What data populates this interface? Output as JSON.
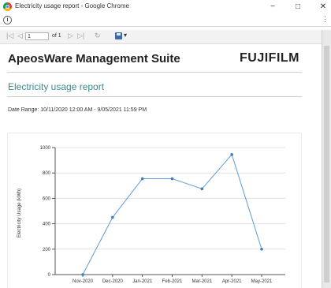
{
  "window": {
    "title": "Electricity usage report - Google Chrome",
    "minimize_glyph": "−",
    "maximize_glyph": "□",
    "close_glyph": "✕",
    "menu_glyph": "⋮",
    "info_glyph": "i"
  },
  "toolbar": {
    "first_page_glyph": "|◁",
    "prev_page_glyph": "◁",
    "page_value": "1",
    "page_of": "of 1",
    "next_page_glyph": "▷",
    "last_page_glyph": "▷|",
    "refresh_glyph": "↻",
    "export_caret": "▾"
  },
  "report": {
    "suite_title": "ApeosWare Management Suite",
    "brand": "FUJIFILM",
    "subtitle": "Electricity usage report",
    "date_range": "Date Range: 10/11/2020 12:00 AM - 9/05/2021 11:59 PM"
  },
  "colors": {
    "accent": "#3b8a8e",
    "line": "#5b9bd5"
  },
  "chart_data": {
    "type": "line",
    "title": "",
    "xlabel": "",
    "ylabel": "Electricity Usage (kWh)",
    "categories": [
      "Nov-2020",
      "Dec-2020",
      "Jan-2021",
      "Feb-2021",
      "Mar-2021",
      "Apr-2021",
      "May-2021"
    ],
    "series": [
      {
        "values": [
          0,
          450,
          755,
          755,
          675,
          945,
          200
        ]
      }
    ],
    "ylim": [
      0,
      1000
    ],
    "yticks": [
      0,
      200,
      400,
      600,
      800,
      1000
    ],
    "grid": true,
    "legend": "none"
  }
}
